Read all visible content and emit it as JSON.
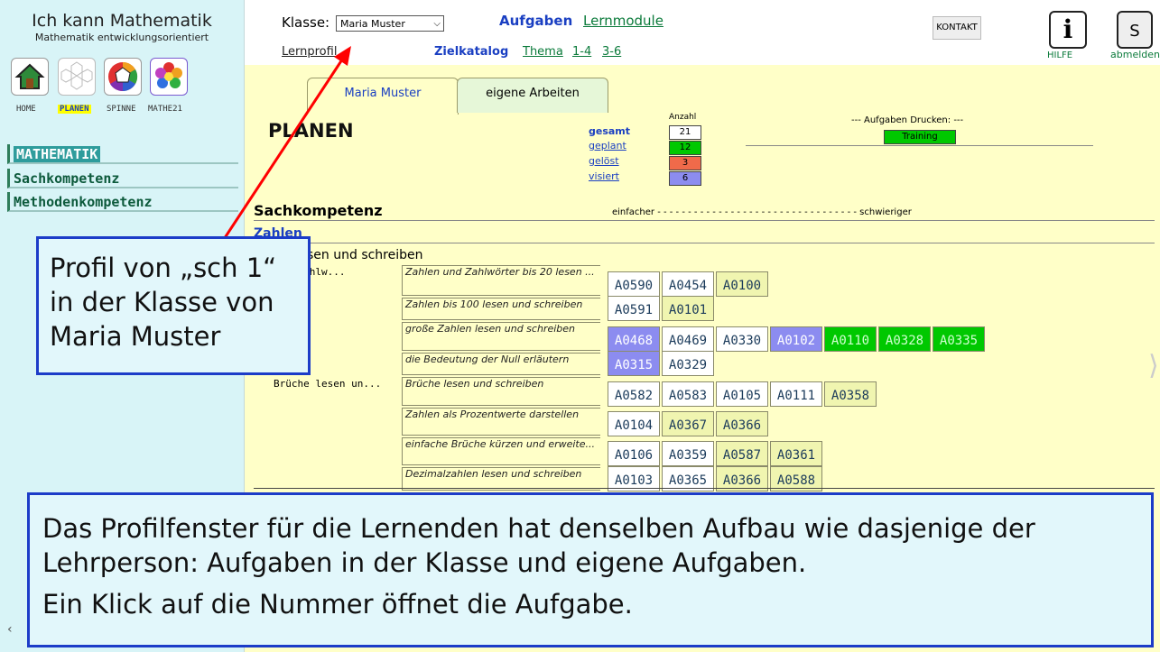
{
  "app": {
    "title": "Ich kann Mathematik",
    "subtitle": "Mathematik entwicklungsorientiert"
  },
  "nav": [
    {
      "label": "HOME",
      "icon": "home-icon"
    },
    {
      "label": "PLANEN",
      "icon": "hexagon-grid-icon",
      "active": true
    },
    {
      "label": "SPINNE",
      "icon": "spider-chart-icon"
    },
    {
      "label": "MATHE21",
      "icon": "flower-icon"
    }
  ],
  "sidebar": {
    "items": [
      {
        "label": "MATHEMATIK",
        "active": true
      },
      {
        "label": "Sachkompetenz"
      },
      {
        "label": "Methodenkompetenz"
      }
    ]
  },
  "header": {
    "klasse_label": "Klasse:",
    "klasse_value": "Maria Muster",
    "aufgaben": "Aufgaben",
    "lernmodule": "Lernmodule",
    "lernprofil": "Lernprofil",
    "zielkatalog": "Zielkatalog",
    "thema": "Thema",
    "range1": "1-4",
    "range2": "3-6",
    "kontakt": "KONTAKT",
    "hilfe": "HILFE",
    "abmelden": "abmelden",
    "user_initial": "S"
  },
  "tabs": [
    {
      "label": "Maria Muster"
    },
    {
      "label": "eigene Arbeiten"
    }
  ],
  "planen": {
    "title": "PLANEN",
    "anzahl_label": "Anzahl",
    "stats": [
      {
        "label": "gesamt",
        "value": "21",
        "color": "#ffffff"
      },
      {
        "label": "geplant",
        "value": "12",
        "color": "#00c800"
      },
      {
        "label": "gelöst",
        "value": "3",
        "color": "#f06a4a"
      },
      {
        "label": "visiert",
        "value": "6",
        "color": "#8c8cf0"
      }
    ],
    "print_label": "--- Aufgaben Drucken: ---",
    "training": "Training"
  },
  "section": {
    "title": "Sachkompetenz",
    "scale": "einfacher - - - - - - - - - - - - - - - - - - - - - - - - - - - - - - - - - schwieriger",
    "subsection": "Zahlen",
    "topic": "sen und schreiben"
  },
  "rows": [
    {
      "group": "und Zahlw...",
      "desc": "Zahlen und Zahlwörter bis 20 lesen ...",
      "codes": [
        [
          "A0590",
          "white"
        ],
        [
          "A0454",
          "white"
        ],
        [
          "A0100",
          "light"
        ]
      ]
    },
    {
      "group": "",
      "desc": "Zahlen bis 100 lesen und schreiben",
      "codes": [
        [
          "A0591",
          "white"
        ],
        [
          "A0101",
          "light"
        ]
      ]
    },
    {
      "group": "",
      "desc": "große Zahlen lesen und schreiben",
      "codes": [
        [
          "A0468",
          "blue"
        ],
        [
          "A0469",
          "white"
        ],
        [
          "A0330",
          "white"
        ],
        [
          "A0102",
          "blue"
        ],
        [
          "A0110",
          "green"
        ],
        [
          "A0328",
          "green"
        ],
        [
          "A0335",
          "green"
        ]
      ]
    },
    {
      "group": "",
      "desc": "die Bedeutung der Null erläutern",
      "codes": [
        [
          "A0315",
          "blue"
        ],
        [
          "A0329",
          "white"
        ]
      ]
    },
    {
      "group": "Brüche lesen un...",
      "desc": "Brüche lesen und schreiben",
      "codes": [
        [
          "A0582",
          "white"
        ],
        [
          "A0583",
          "white"
        ],
        [
          "A0105",
          "white"
        ],
        [
          "A0111",
          "white"
        ],
        [
          "A0358",
          "light"
        ]
      ]
    },
    {
      "group": "",
      "desc": "Zahlen als Prozentwerte darstellen",
      "codes": [
        [
          "A0104",
          "white"
        ],
        [
          "A0367",
          "light"
        ],
        [
          "A0366",
          "light"
        ]
      ]
    },
    {
      "group": "",
      "desc": "einfache Brüche kürzen und erweite...",
      "codes": [
        [
          "A0106",
          "white"
        ],
        [
          "A0359",
          "white"
        ],
        [
          "A0587",
          "light"
        ],
        [
          "A0361",
          "light"
        ]
      ]
    },
    {
      "group": "",
      "desc": "Dezimalzahlen lesen und schreiben",
      "codes": [
        [
          "A0103",
          "white"
        ],
        [
          "A0365",
          "white"
        ],
        [
          "A0366",
          "light"
        ],
        [
          "A0588",
          "light"
        ]
      ]
    }
  ],
  "callouts": {
    "small": "Profil von „sch 1“ in der Klasse von Maria Muster",
    "big_line1": "Das Profilfenster für die Lernenden hat denselben Aufbau wie dasjenige der Lehrperson: Aufgaben in der Klasse und eigene Aufgaben.",
    "big_line2": "Ein Klick auf die Nummer öffnet die Aufgabe."
  },
  "colors": {
    "accent": "#1a3fc2",
    "sidebar": "#d8f4f7",
    "main": "#ffffc8",
    "arrow": "#ff0000"
  }
}
